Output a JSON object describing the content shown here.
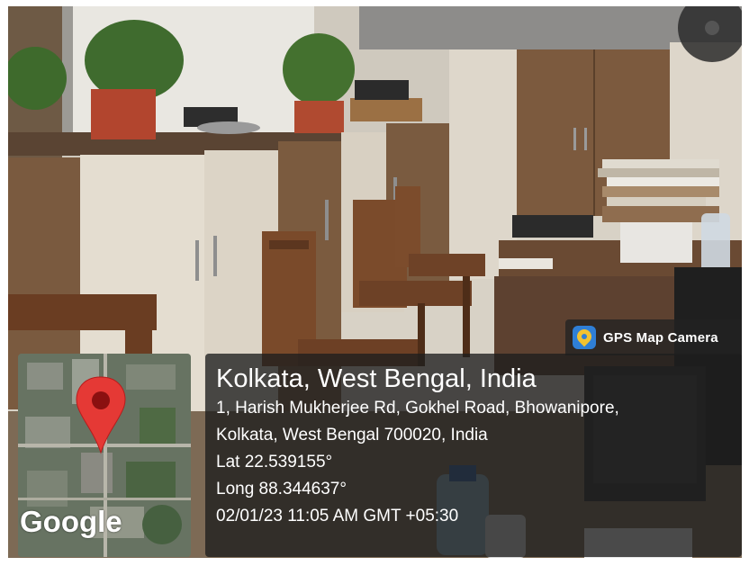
{
  "brand": {
    "label": "GPS Map Camera",
    "icon": "map-pin-app-icon"
  },
  "location": {
    "title": "Kolkata, West Bengal, India",
    "address_line1": "1, Harish Mukherjee Rd, Gokhel Road, Bhowanipore,",
    "address_line2": "Kolkata, West Bengal 700020, India",
    "lat": "Lat 22.539155°",
    "long": "Long 88.344637°",
    "datetime": "02/01/23 11:05 AM GMT +05:30"
  },
  "map": {
    "attribution": "Google",
    "marker_icon": "location-pin-icon",
    "marker_color": "#e53935"
  },
  "colors": {
    "overlay": "#1e1e1e",
    "brand_icon": "#2f7fd6"
  }
}
